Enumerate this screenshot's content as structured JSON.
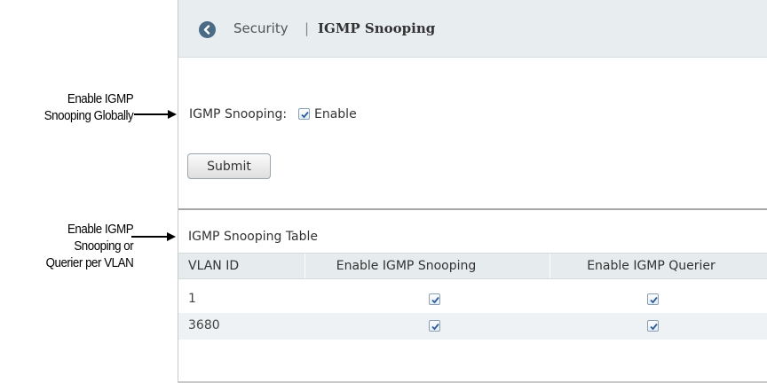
{
  "callouts": {
    "enable_global": [
      "Enable IGMP",
      "Snooping Globally"
    ],
    "enable_per_vlan": [
      "Enable IGMP",
      "Snooping or",
      "Querier per VLAN"
    ]
  },
  "header": {
    "breadcrumb_root": "Security",
    "separator": "|",
    "title": "IGMP Snooping",
    "back_icon": "chevron-left-circle-icon"
  },
  "form": {
    "label": "IGMP Snooping:",
    "enable_label": "Enable",
    "enable_checked": true,
    "submit_label": "Submit"
  },
  "table": {
    "title": "IGMP Snooping Table",
    "columns": [
      "VLAN ID",
      "Enable IGMP Snooping",
      "Enable IGMP Querier"
    ],
    "rows": [
      {
        "vlan_id": "1",
        "snooping": true,
        "querier": true
      },
      {
        "vlan_id": "3680",
        "snooping": true,
        "querier": true
      }
    ]
  },
  "colors": {
    "header_bg": "#e8edf0",
    "back_button": "#4b6a86",
    "check_mark": "#2a5d9f"
  }
}
